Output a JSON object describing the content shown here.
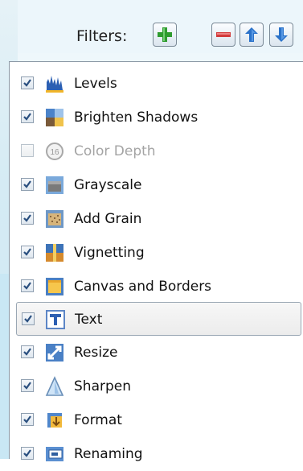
{
  "toolbar": {
    "label": "Filters:",
    "buttons": [
      {
        "name": "add",
        "icon": "plus-icon",
        "color": "#2f9c2f"
      },
      {
        "name": "remove",
        "icon": "minus-icon",
        "color": "#d23b3b"
      },
      {
        "name": "move-up",
        "icon": "arrow-up-icon",
        "color": "#2b72c9"
      },
      {
        "name": "move-down",
        "icon": "arrow-down-icon",
        "color": "#2b72c9"
      }
    ]
  },
  "filters": [
    {
      "label": "Levels",
      "checked": true,
      "enabled": true,
      "icon": "levels-icon"
    },
    {
      "label": "Brighten Shadows",
      "checked": true,
      "enabled": true,
      "icon": "brighten-shadows-icon"
    },
    {
      "label": "Color Depth",
      "checked": false,
      "enabled": false,
      "icon": "color-depth-icon"
    },
    {
      "label": "Grayscale",
      "checked": true,
      "enabled": true,
      "icon": "grayscale-icon"
    },
    {
      "label": "Add Grain",
      "checked": true,
      "enabled": true,
      "icon": "add-grain-icon"
    },
    {
      "label": "Vignetting",
      "checked": true,
      "enabled": true,
      "icon": "vignetting-icon"
    },
    {
      "label": "Canvas and Borders",
      "checked": true,
      "enabled": true,
      "icon": "canvas-borders-icon"
    },
    {
      "label": "Text",
      "checked": true,
      "enabled": true,
      "icon": "text-icon",
      "selected": true
    },
    {
      "label": "Resize",
      "checked": true,
      "enabled": true,
      "icon": "resize-icon"
    },
    {
      "label": "Sharpen",
      "checked": true,
      "enabled": true,
      "icon": "sharpen-icon"
    },
    {
      "label": "Format",
      "checked": true,
      "enabled": true,
      "icon": "format-icon"
    },
    {
      "label": "Renaming",
      "checked": true,
      "enabled": true,
      "icon": "renaming-icon"
    }
  ]
}
